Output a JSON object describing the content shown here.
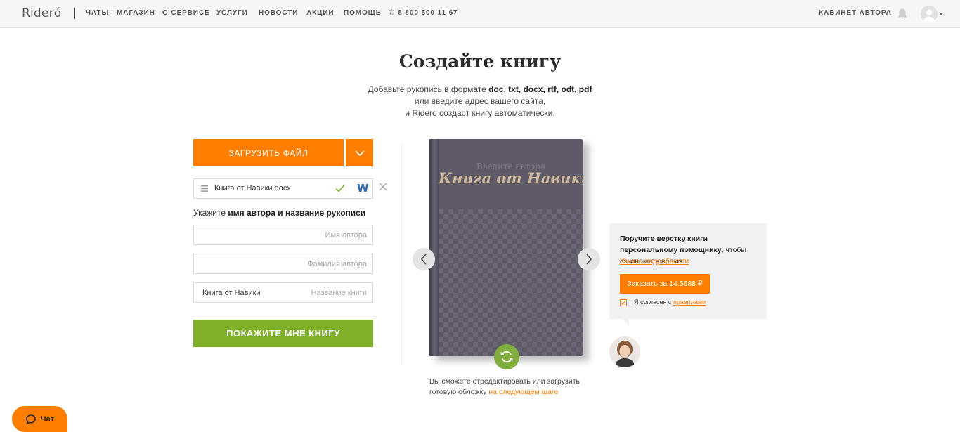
{
  "header": {
    "logo": "Riderо́",
    "nav": [
      "ЧАТЫ",
      "МАГАЗИН",
      "О СЕРВИСЕ",
      "УСЛУГИ",
      "НОВОСТИ",
      "АКЦИИ",
      "ПОМОЩЬ"
    ],
    "phone": "8 800 500 11 67",
    "cabinet": "КАБИНЕТ АВТОРА"
  },
  "intro": {
    "title": "Создайте книгу",
    "line1_prefix": "Добавьте рукопись в формате ",
    "line1_formats": "doc, txt, docx, rtf, odt, pdf",
    "line2": "или введите адрес вашего сайта,",
    "line3": "и Ridero создаст книгу автоматически."
  },
  "form": {
    "upload_label": "ЗАГРУЗИТЬ ФАЙЛ",
    "file_name": "Книга от Навики.docx",
    "file_type_letter": "W",
    "hint_prefix": "Укажите ",
    "hint_bold": "имя автора и название рукописи",
    "first_name": {
      "value": "",
      "placeholder": "Имя автора"
    },
    "last_name": {
      "value": "",
      "placeholder": "Фамилия автора"
    },
    "book_title": {
      "value": "Книга от Навики",
      "placeholder": "Название книги"
    },
    "submit_label": "ПОКАЖИТЕ МНЕ КНИГУ"
  },
  "book": {
    "author_placeholder": "Введите автора",
    "title": "Книга от Навики",
    "note_prefix": "Вы сможете отредактировать или загрузить готовую обложку ",
    "note_link": "на следующем шаге"
  },
  "promo": {
    "text_bold": "Поручите верстку книги персональному помощнику",
    "text_rest": ", чтобы сэкономить время",
    "link": "Узнать подробности",
    "button": "Заказать за 14.5588 ₽",
    "agree_prefix": "Я согласен с ",
    "agree_link": "правилами",
    "agree_checked": true
  },
  "chat": {
    "label": "Чат"
  },
  "colors": {
    "accent": "#ff7e00",
    "green": "#7fb128",
    "book": "#5d5866",
    "book_title": "#cdb99c"
  }
}
